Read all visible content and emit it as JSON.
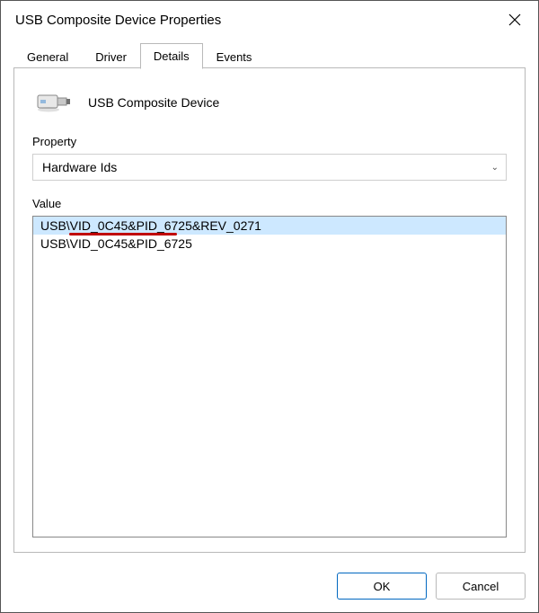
{
  "window": {
    "title": "USB Composite Device Properties"
  },
  "tabs": {
    "general": "General",
    "driver": "Driver",
    "details": "Details",
    "events": "Events",
    "active": "details"
  },
  "device": {
    "name": "USB Composite Device"
  },
  "property_section": {
    "label": "Property",
    "selected": "Hardware Ids"
  },
  "value_section": {
    "label": "Value",
    "items": [
      "USB\\VID_0C45&PID_6725&REV_0271",
      "USB\\VID_0C45&PID_6725"
    ],
    "selected_index": 0
  },
  "buttons": {
    "ok": "OK",
    "cancel": "Cancel"
  }
}
